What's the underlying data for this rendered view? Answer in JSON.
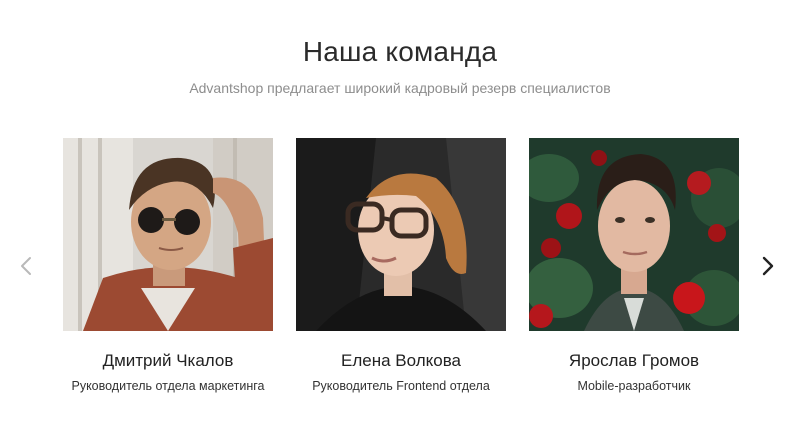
{
  "section": {
    "title": "Наша команда",
    "subtitle": "Advantshop предлагает широкий кадровый резерв специалистов"
  },
  "navigation": {
    "prev_icon": "chevron-left-icon",
    "next_icon": "chevron-right-icon",
    "prev_color": "#b9b9b9",
    "next_color": "#222222"
  },
  "team": [
    {
      "name": "Дмитрий Чкалов",
      "role": "Руководитель отдела маркетинга"
    },
    {
      "name": "Елена Волкова",
      "role": "Руководитель Frontend отдела"
    },
    {
      "name": "Ярослав Громов",
      "role": "Mobile-разработчик"
    }
  ]
}
